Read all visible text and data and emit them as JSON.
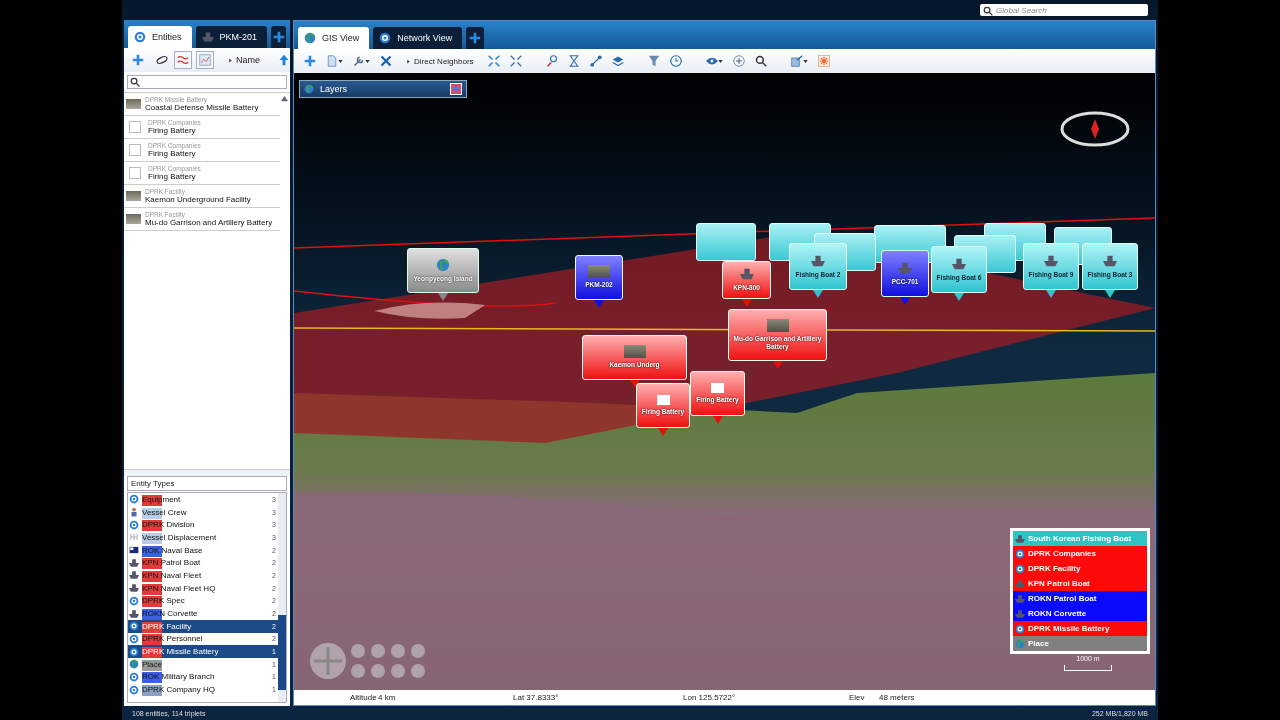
{
  "top_bar": {
    "search": {
      "placeholder": "Global Search"
    }
  },
  "left_tabs": [
    {
      "label": "Entities",
      "selected": true
    },
    {
      "label": "PKM-201",
      "selected": false
    }
  ],
  "sort": {
    "label": "Name"
  },
  "entities": [
    {
      "category": "DPRK  Missile Battery",
      "name": "Coastal Defense Missile Battery",
      "kind": "photo"
    },
    {
      "category": "DPRK Companies",
      "name": "Firing Battery",
      "kind": "badge"
    },
    {
      "category": "DPRK Companies",
      "name": "Firing Battery",
      "kind": "badge"
    },
    {
      "category": "DPRK Companies",
      "name": "Firing Battery",
      "kind": "badge"
    },
    {
      "category": "DPRK Facility",
      "name": "Kaemon Underground Facility",
      "kind": "photo"
    },
    {
      "category": "DPRK Facility",
      "name": "Mu-do Garrison and Artillery Battery",
      "kind": "photo"
    }
  ],
  "types_field": {
    "value": "Entity Types"
  },
  "entity_types": [
    {
      "name": "Equipment",
      "color": "#e23a3a",
      "kind": "gear",
      "count": "3",
      "selected": false
    },
    {
      "name": "Vessel Crew",
      "color": "#b8cce8",
      "kind": "person",
      "count": "3",
      "selected": false
    },
    {
      "name": "DPRK Division",
      "color": "#e23a3a",
      "kind": "gear",
      "count": "3",
      "selected": false
    },
    {
      "name": "Vessel Displacement",
      "color": "#b8cce8",
      "kind": "grid",
      "count": "3",
      "selected": false
    },
    {
      "name": "ROK Naval Base",
      "color": "#3b5fe0",
      "kind": "flag",
      "count": "2",
      "selected": false
    },
    {
      "name": "KPN Patrol Boat",
      "color": "#e23a3a",
      "kind": "ship",
      "count": "2",
      "selected": false
    },
    {
      "name": "KPN Naval Fleet",
      "color": "#e23a3a",
      "kind": "ship",
      "count": "2",
      "selected": false
    },
    {
      "name": "KPN Naval Fleet HQ",
      "color": "#e23a3a",
      "kind": "ship",
      "count": "2",
      "selected": false
    },
    {
      "name": "DPRK Spec",
      "color": "#e23a3a",
      "kind": "gear",
      "count": "2",
      "selected": false
    },
    {
      "name": "ROKN Corvette",
      "color": "#3b5fe0",
      "kind": "ship",
      "count": "2",
      "selected": false
    },
    {
      "name": "DPRK Facility",
      "color": "#e23a3a",
      "kind": "gear",
      "count": "2",
      "selected": true
    },
    {
      "name": "DPRK Personnel",
      "color": "#e23a3a",
      "kind": "gear",
      "count": "2",
      "selected": false
    },
    {
      "name": "DPRK  Missile Battery",
      "color": "#e23a3a",
      "kind": "gear",
      "count": "1",
      "selected": true
    },
    {
      "name": "Place",
      "color": "#9a9a9a",
      "kind": "globe",
      "count": "1",
      "selected": false
    },
    {
      "name": "ROK Military Branch",
      "color": "#3b5fe0",
      "kind": "gear",
      "count": "1",
      "selected": false
    },
    {
      "name": "DPRK Company HQ",
      "color": "#8aa0c0",
      "kind": "gear",
      "count": "1",
      "selected": false
    }
  ],
  "right_tabs": [
    {
      "label": "GIS View",
      "selected": true
    },
    {
      "label": "Network View",
      "selected": false
    }
  ],
  "toolbar": {
    "neighbors": "Direct Neighbors"
  },
  "layers": {
    "title": "Layers"
  },
  "markers": [
    {
      "kind": "place",
      "label": "Yeonpyeong Island"
    },
    {
      "kind": "rokphoto",
      "label": "PKM-202"
    },
    {
      "kind": "fishing",
      "label": "Fishing Boat 2"
    },
    {
      "kind": "fishing",
      "label": "Fishing Boat 6"
    },
    {
      "kind": "fishing",
      "label": "Fishing Boat 9"
    },
    {
      "kind": "fishing",
      "label": "Fishing Boat 3"
    },
    {
      "kind": "rokship",
      "label": "PCC-701"
    },
    {
      "kind": "dprkship",
      "label": "KPN-800"
    },
    {
      "kind": "dprkphoto",
      "label": "Mu-do Garrison and Artillery Battery"
    },
    {
      "kind": "dprkphoto",
      "label": "Kaemon Underg"
    },
    {
      "kind": "dprkbadge",
      "label": "Firing Battery"
    },
    {
      "kind": "dprkbadge",
      "label": "Firing Battery"
    }
  ],
  "legend": [
    {
      "label": "South Korean Fishing Boat",
      "color": "#2ec4c4",
      "kind": "ship"
    },
    {
      "label": "DPRK Companies",
      "color": "#ff0a0a",
      "kind": "gear"
    },
    {
      "label": "DPRK Facility",
      "color": "#ff0a0a",
      "kind": "gear"
    },
    {
      "label": "KPN Patrol Boat",
      "color": "#ff0a0a",
      "kind": "ship"
    },
    {
      "label": "ROKN Patrol Boat",
      "color": "#0a0aff",
      "kind": "ship"
    },
    {
      "label": "ROKN Corvette",
      "color": "#0a0aff",
      "kind": "ship"
    },
    {
      "label": "DPRK  Missile Battery",
      "color": "#ff0a0a",
      "kind": "gear"
    },
    {
      "label": "Place",
      "color": "#808080",
      "kind": "globe"
    }
  ],
  "scale": "1000 m",
  "status": {
    "altitude_label": "Altitude",
    "altitude": "4 km",
    "lat": "Lat 37.8333°",
    "lon": "Lon 125.5722°",
    "elev_label": "Elev",
    "elev": "48 meters"
  },
  "footer": {
    "entities": "108 entities, 114 triplets",
    "memory": "252 MB/1,820 MB"
  }
}
